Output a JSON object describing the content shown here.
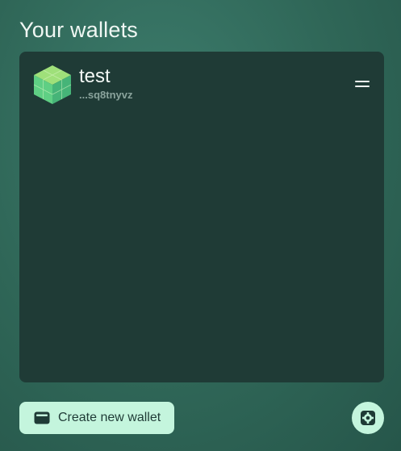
{
  "page": {
    "title": "Your wallets"
  },
  "wallets": [
    {
      "name": "test",
      "address_short": "...sq8tnyvz",
      "avatar": "green-cube-avatar"
    }
  ],
  "actions": {
    "create_label": "Create new wallet",
    "create_icon": "wallet-icon",
    "settings_icon": "gear-icon"
  },
  "colors": {
    "background": "#2f6657",
    "panel": "#1f3b36",
    "button": "#c4f5dd",
    "button_text": "#1f3b36"
  }
}
